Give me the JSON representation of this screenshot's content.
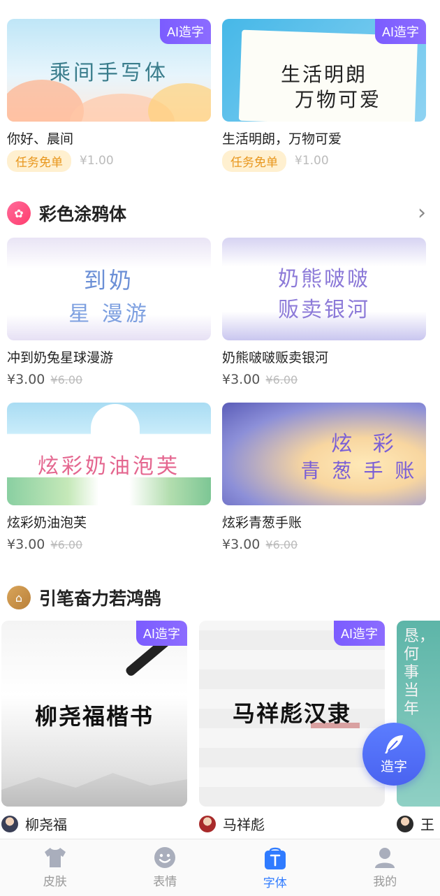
{
  "ai_tag": "AI造字",
  "top_grid": [
    {
      "art_lines": [
        "乘间手写体"
      ],
      "title": "你好、晨间",
      "badge": "任务免单",
      "price": "¥1.00"
    },
    {
      "art_lines": [
        "生活明朗",
        "万物可爱"
      ],
      "title": "生活明朗，万物可爱",
      "badge": "任务免单",
      "price": "¥1.00"
    }
  ],
  "section_colorful": {
    "title": "彩色涂鸦体",
    "items": [
      {
        "art_lines": [
          "到奶",
          "星 漫游"
        ],
        "title": "冲到奶兔星球漫游",
        "price": "¥3.00",
        "old_price": "¥6.00"
      },
      {
        "art_lines": [
          "奶熊啵啵",
          "贩卖银河"
        ],
        "title": "奶熊啵啵贩卖银河",
        "price": "¥3.00",
        "old_price": "¥6.00"
      },
      {
        "art_lines": [
          "炫彩奶油泡芙"
        ],
        "title": "炫彩奶油泡芙",
        "price": "¥3.00",
        "old_price": "¥6.00"
      },
      {
        "art_lines": [
          "炫  彩",
          "青 葱 手 账"
        ],
        "title": "炫彩青葱手账",
        "price": "¥3.00",
        "old_price": "¥6.00"
      }
    ]
  },
  "section_brush": {
    "title": "引笔奋力若鸿鹄",
    "items": [
      {
        "art": "柳尧福楷书",
        "author": "柳尧福"
      },
      {
        "art": "马祥彪汉隶",
        "author": "马祥彪"
      },
      {
        "art": "恳，何事当年",
        "author": "王"
      }
    ]
  },
  "fab": {
    "label": "造字"
  },
  "tabs": [
    {
      "label": "皮肤",
      "icon": "shirt-icon"
    },
    {
      "label": "表情",
      "icon": "smiley-icon"
    },
    {
      "label": "字体",
      "icon": "font-icon"
    },
    {
      "label": "我的",
      "icon": "user-icon"
    }
  ],
  "colors": {
    "accent": "#2f7bff",
    "ai_tag": "#7b5cff",
    "badge_text": "#e8961c",
    "badge_bg": "#fff0d0",
    "fab": "#4a63f0"
  }
}
